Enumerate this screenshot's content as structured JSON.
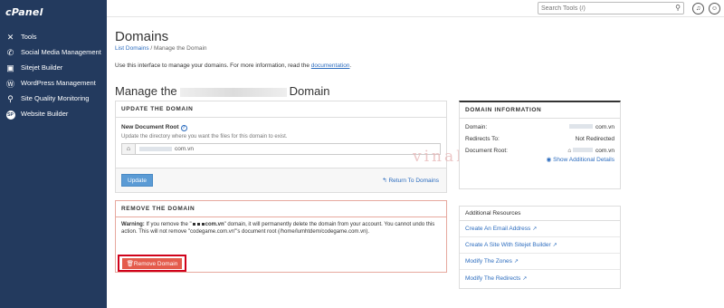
{
  "app": {
    "logo": "cPanel"
  },
  "sidebar": {
    "items": [
      {
        "label": "Tools",
        "icon": "tools-icon",
        "glyph": "✕"
      },
      {
        "label": "Social Media Management",
        "icon": "megaphone-icon",
        "glyph": "✆"
      },
      {
        "label": "Sitejet Builder",
        "icon": "sitejet-icon",
        "glyph": "▣"
      },
      {
        "label": "WordPress Management",
        "icon": "wordpress-icon",
        "glyph": "Ⓦ"
      },
      {
        "label": "Site Quality Monitoring",
        "icon": "monitor-icon",
        "glyph": "⚲"
      },
      {
        "label": "Website Builder",
        "icon": "sp-icon",
        "glyph": "SP"
      }
    ]
  },
  "topbar": {
    "search_placeholder": "Search Tools (/)"
  },
  "page": {
    "title": "Domains",
    "breadcrumb_link": "List Domains",
    "breadcrumb_sep": " / ",
    "breadcrumb_current": "Manage the Domain",
    "intro_text": "Use this interface to manage your domains. For more information, read the ",
    "intro_link": "documentation",
    "intro_end": ".",
    "manage_prefix": "Manage the",
    "manage_suffix": "Domain"
  },
  "update": {
    "heading": "UPDATE THE DOMAIN",
    "field_label": "New Document Root",
    "field_help": "Update the directory where you want the files for this domain to exist.",
    "field_suffix": "com.vn",
    "update_button": "Update",
    "return_link": "Return To Domains"
  },
  "watermark": "vinahost",
  "remove": {
    "heading": "REMOVE THE DOMAIN",
    "warning_label": "Warning:",
    "warning_pre": " If you remove the \"",
    "warning_domain": "com.vn",
    "warning_post": "\" domain, it will permanently delete the domain from your account. You cannot undo this action. This will not remove \"codegame.com.vn\"'s document root (/home/lumhtdem/codegame.com.vn).",
    "button": "Remove Domain"
  },
  "info": {
    "heading": "DOMAIN INFORMATION",
    "domain_label": "Domain:",
    "domain_value": "com.vn",
    "redirects_label": "Redirects To:",
    "redirects_value": "Not Redirected",
    "docroot_label": "Document Root:",
    "docroot_value": "com.vn",
    "show_more": "Show Additional Details"
  },
  "resources": {
    "heading": "Additional Resources",
    "items": [
      "Create An Email Address",
      "Create A Site With Sitejet Builder",
      "Modify The Zones",
      "Modify The Redirects"
    ]
  }
}
